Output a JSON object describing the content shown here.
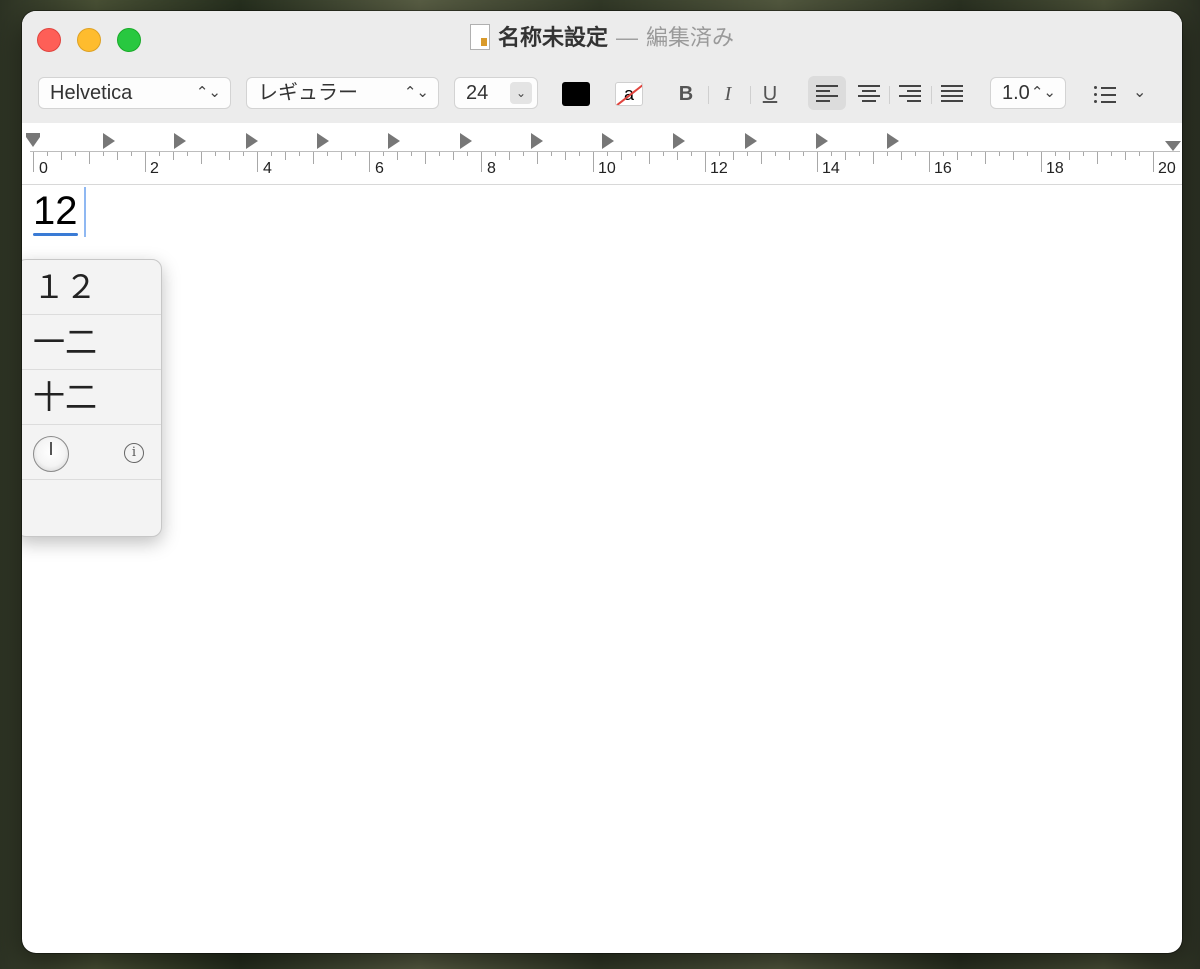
{
  "window": {
    "title": "名称未設定",
    "title_separator": "—",
    "edit_state": "編集済み"
  },
  "toolbar": {
    "font_family": "Helvetica",
    "font_style": "レギュラー",
    "font_size": "24",
    "text_color": "#000000",
    "background_color_glyph": "a",
    "bold_label": "B",
    "italic_label": "I",
    "underline_label": "U",
    "line_spacing": "1.0",
    "selected_alignment": "left"
  },
  "ruler": {
    "labels": [
      "0",
      "2",
      "4",
      "6",
      "8",
      "10",
      "12",
      "14",
      "16",
      "18",
      "20"
    ]
  },
  "document": {
    "text": "12"
  },
  "candidates": {
    "items": [
      "１２",
      "一二",
      "十二"
    ],
    "info_glyph": "i"
  },
  "colors": {
    "accent": "#3a7bd5",
    "close": "#fe5f57",
    "minimize": "#febc2e",
    "maximize": "#28c840"
  }
}
